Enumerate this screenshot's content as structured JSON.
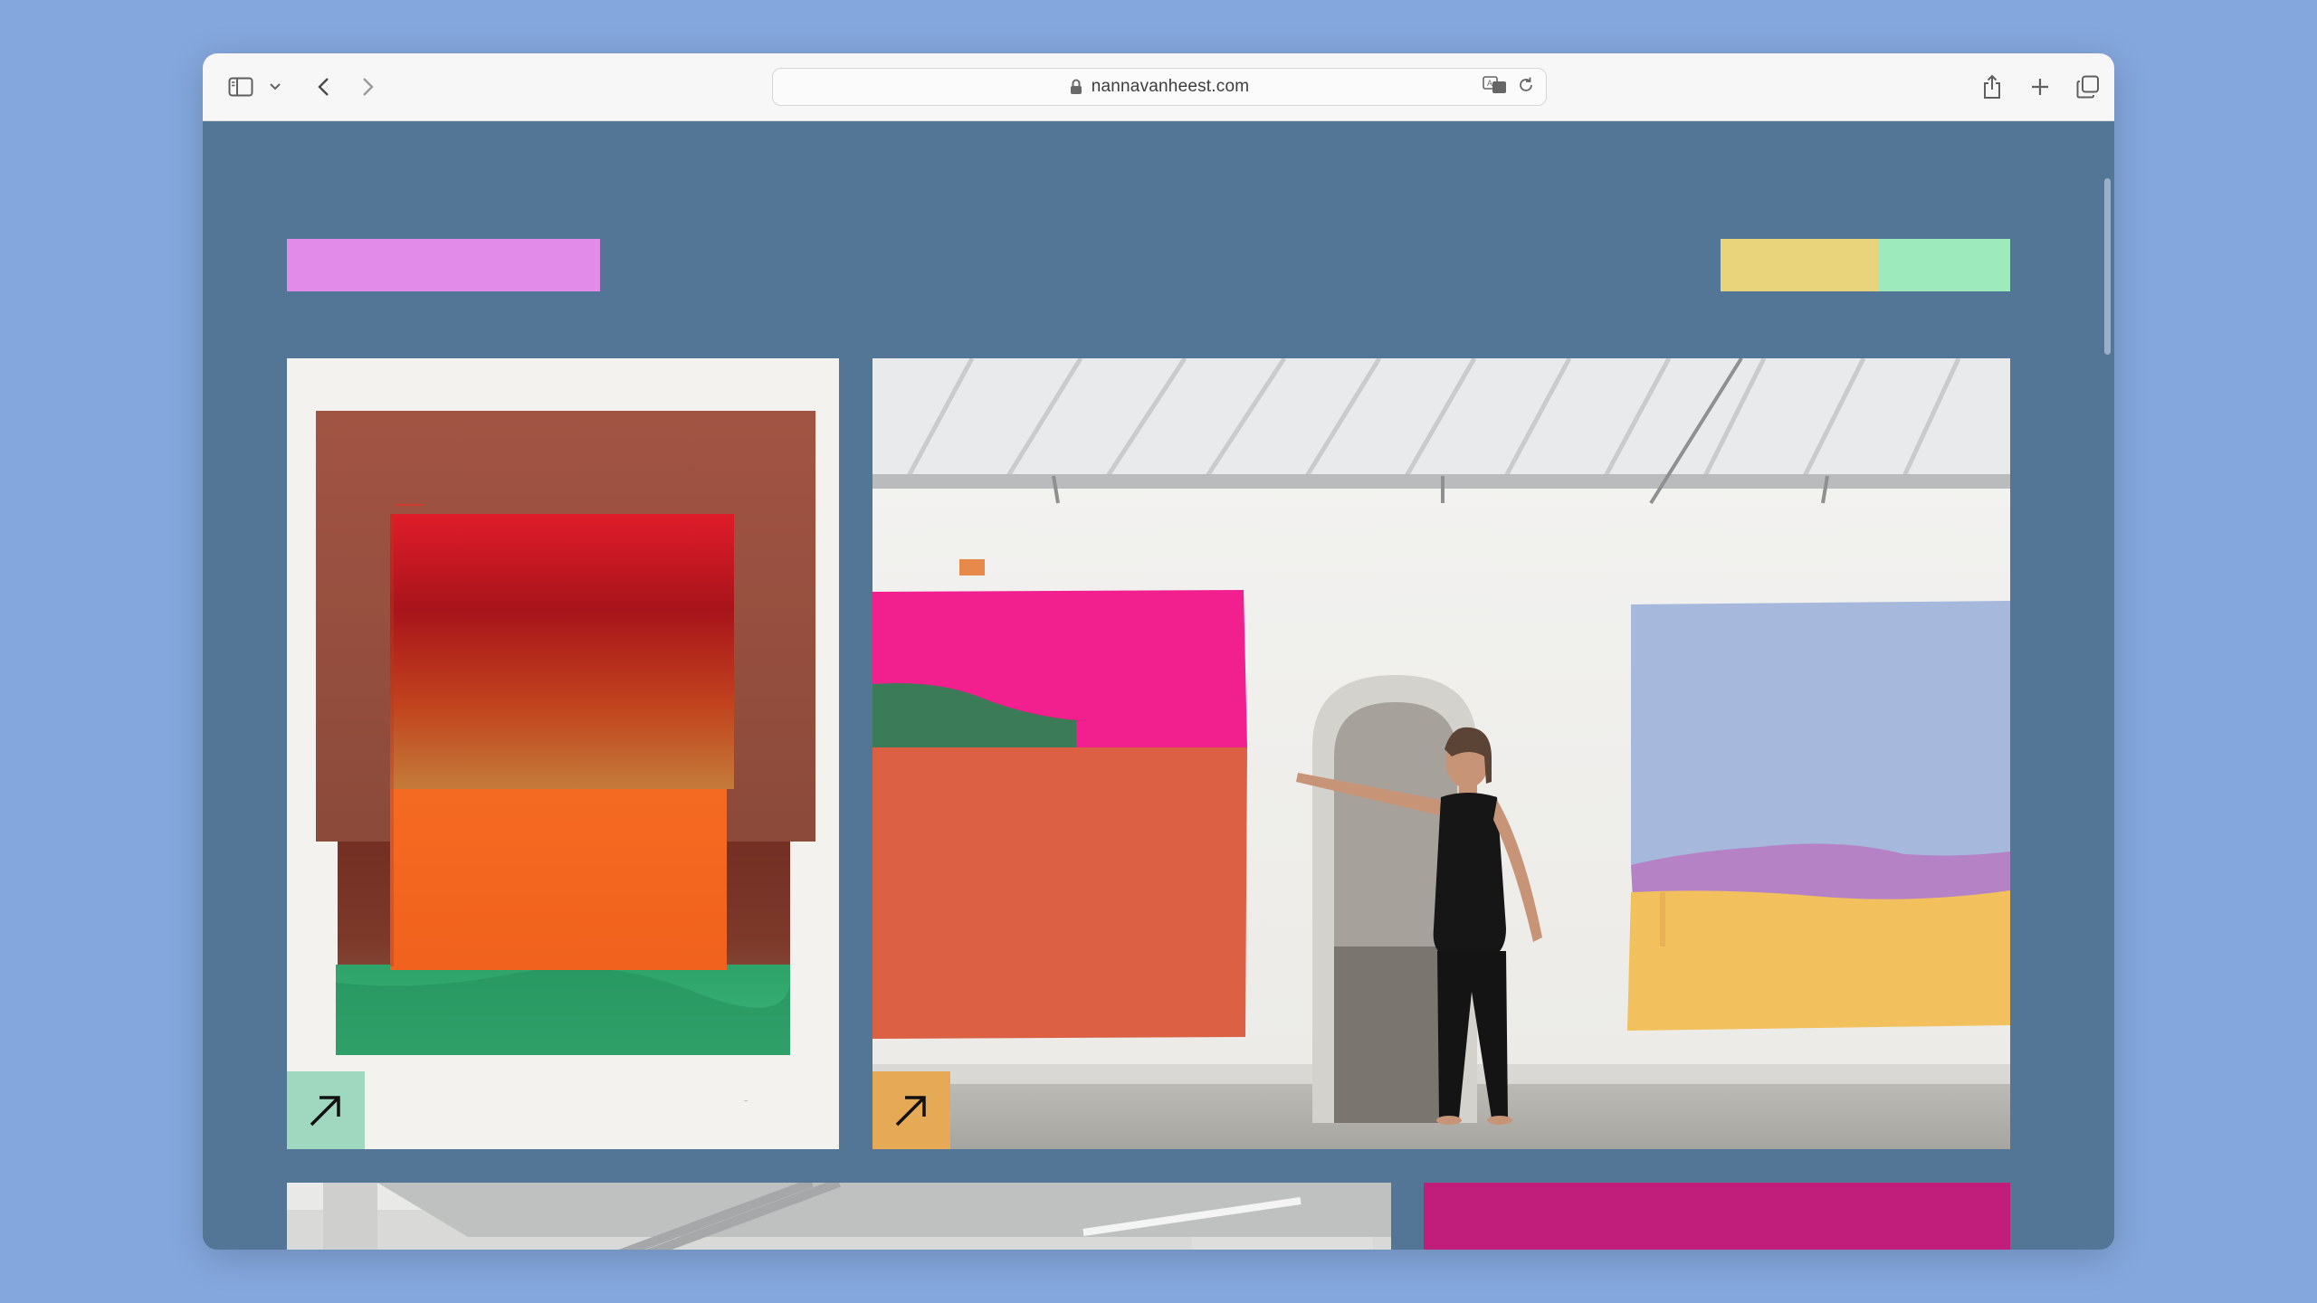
{
  "browser": {
    "url": "nannavanheest.com",
    "icons": [
      "sidebar-icon",
      "chevron-down-icon",
      "back-icon",
      "forward-icon",
      "lock-icon",
      "translate-icon",
      "reload-icon",
      "share-icon",
      "plus-icon",
      "tabs-icon"
    ]
  },
  "colors": {
    "desktop_bg": "#84a7dd",
    "page_bg": "#537596",
    "logo": "#e28be9",
    "menu_yellow": "#ead47b",
    "menu_mint": "#9debbd",
    "tag_mint": "#9fd8bf",
    "tag_orange": "#e6a955"
  },
  "cards": [
    {
      "name": "painting-print",
      "tag_icon": "arrow-up-right-icon"
    },
    {
      "name": "studio-photo",
      "tag_icon": "arrow-up-right-icon"
    },
    {
      "name": "studio-wide-photo"
    },
    {
      "name": "magenta-painting"
    }
  ]
}
